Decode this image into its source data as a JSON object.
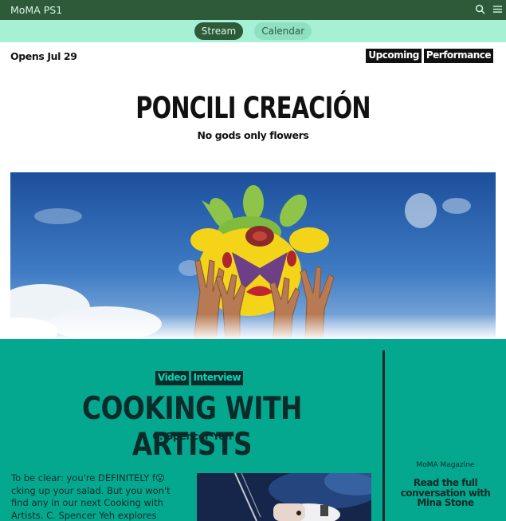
{
  "header": {
    "brand": "MoMA PS1",
    "icons": [
      "search-icon",
      "menu-icon"
    ],
    "colors": {
      "bar": "#2f5a3a",
      "subnav": "#a6f1d6"
    }
  },
  "subnav": {
    "tabs": [
      {
        "label": "Stream",
        "active": true
      },
      {
        "label": "Calendar",
        "active": false
      }
    ]
  },
  "event": {
    "opens": "Opens Jul 29",
    "tags": [
      "Upcoming",
      "Performance"
    ],
    "title": "PONCILI CREACIÓN",
    "subtitle": "No gods only flowers"
  },
  "feature": {
    "background": "#04a88e",
    "tags": [
      "Video",
      "Interview"
    ],
    "title": "COOKING WITH ARTISTS",
    "byline": "C. Spencer Yeh",
    "paragraph": "To be clear: you're DEFINITELY f😮cking up your salad. But you won't find any in our next Cooking with Artists. C. Spencer Yeh explores noise, embodiment, and"
  },
  "sidebar": {
    "label": "MoMA Magazine",
    "link": "Read the full conversation with Mina Stone"
  }
}
